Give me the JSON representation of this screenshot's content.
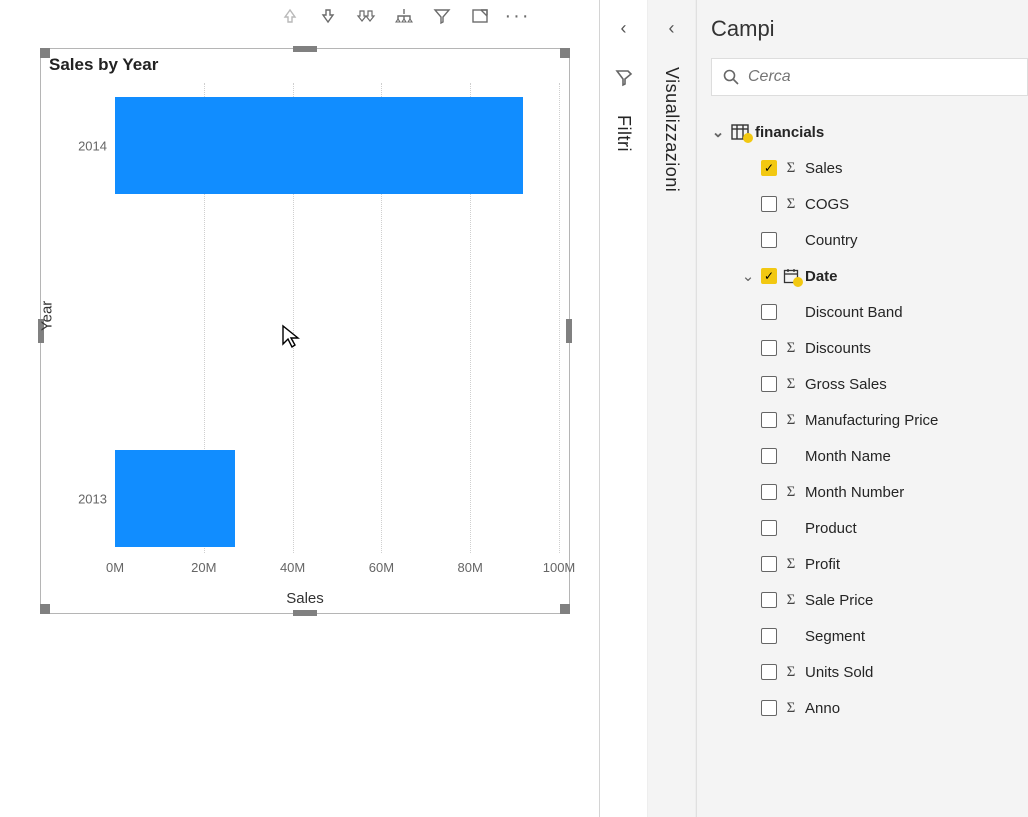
{
  "chart_data": {
    "type": "bar",
    "orientation": "horizontal",
    "title": "Sales by Year",
    "xlabel": "Sales",
    "ylabel": "Year",
    "categories": [
      "2014",
      "2013"
    ],
    "values": [
      92000000,
      27000000
    ],
    "x_ticks": [
      "0M",
      "20M",
      "40M",
      "60M",
      "80M",
      "100M"
    ],
    "xlim": [
      0,
      100000000
    ],
    "bar_color": "#118dff"
  },
  "panes": {
    "filters": {
      "label": "Filtri"
    },
    "visualizations": {
      "label": "Visualizzazioni"
    },
    "fields": {
      "title": "Campi",
      "search_placeholder": "Cerca"
    }
  },
  "fields_tree": {
    "table_name": "financials",
    "items": [
      {
        "label": "Sales",
        "checked": true,
        "sigma": true,
        "hierarchy": false
      },
      {
        "label": "COGS",
        "checked": false,
        "sigma": true,
        "hierarchy": false
      },
      {
        "label": "Country",
        "checked": false,
        "sigma": false,
        "hierarchy": false
      },
      {
        "label": "Date",
        "checked": true,
        "sigma": false,
        "hierarchy": true,
        "bold": true
      },
      {
        "label": "Discount Band",
        "checked": false,
        "sigma": false,
        "hierarchy": false
      },
      {
        "label": "Discounts",
        "checked": false,
        "sigma": true,
        "hierarchy": false
      },
      {
        "label": "Gross Sales",
        "checked": false,
        "sigma": true,
        "hierarchy": false
      },
      {
        "label": "Manufacturing Price",
        "checked": false,
        "sigma": true,
        "hierarchy": false
      },
      {
        "label": "Month Name",
        "checked": false,
        "sigma": false,
        "hierarchy": false
      },
      {
        "label": "Month Number",
        "checked": false,
        "sigma": true,
        "hierarchy": false
      },
      {
        "label": "Product",
        "checked": false,
        "sigma": false,
        "hierarchy": false
      },
      {
        "label": "Profit",
        "checked": false,
        "sigma": true,
        "hierarchy": false
      },
      {
        "label": "Sale Price",
        "checked": false,
        "sigma": true,
        "hierarchy": false
      },
      {
        "label": "Segment",
        "checked": false,
        "sigma": false,
        "hierarchy": false
      },
      {
        "label": "Units Sold",
        "checked": false,
        "sigma": true,
        "hierarchy": false
      },
      {
        "label": "Anno",
        "checked": false,
        "sigma": true,
        "hierarchy": false
      }
    ]
  }
}
